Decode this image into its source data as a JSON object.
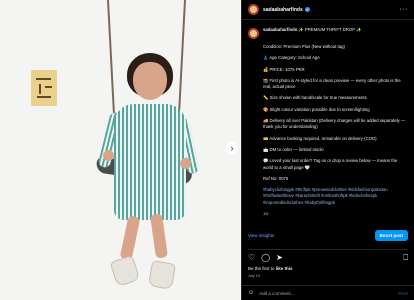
{
  "header": {
    "username": "sadaabaharfinds",
    "verified_glyph": "✓",
    "more_icon": "more-horizontal-icon",
    "more_label": "···"
  },
  "photo": {
    "next_label": "›"
  },
  "caption": {
    "username": "sadaabaharfinds",
    "title": "✨ PREMIUM THRIFT DROP ✨",
    "lines": [
      "Condition: Premium Plus (New without tag)",
      "👗 Age Category: School Age",
      "💰 PRICE: 1075 PKR",
      "📸 First photo is AI-styled for a clean preview — every other photo is the real, actual piece",
      "📏 Size shown with hand/scale for true measurements",
      "🎨 Slight colour variation possible due to screen/lighting",
      "🚚 Delivery all over Pakistan (Delivery charges will be added separately — thank you for understanding)",
      "💳 Advance booking required, remainder on delivery (COD)",
      "📩 DM to order — limited stock!",
      "💬 Loved your last order? Tag us or drop a review below — means the world to a small page 🤍"
    ],
    "ref": "Ref No: 0075",
    "hashtags": "#babyclothingpk #thriftpk #preownedclothes #kidsfashionpakistan #thriftedwithlove #karachithrift #onlinethriftpk #kidsclothespk #importedkidsclothes #babythriftingpk",
    "timestamp": "1w"
  },
  "insights": {
    "view_label": "View insights",
    "boost_label": "Boost post"
  },
  "actions": {
    "like_icon": "heart-icon",
    "comment_icon": "comment-icon",
    "share_icon": "share-icon",
    "save_icon": "bookmark-icon",
    "like_glyph": "♡",
    "comment_glyph": "◯",
    "share_glyph": "➤",
    "save_glyph": "⎕"
  },
  "likes": {
    "prefix": "Be the first to",
    "cta": "like this"
  },
  "date": "July 19",
  "comment": {
    "emoji_glyph": "☺",
    "placeholder": "Add a comment...",
    "post_label": "Post"
  }
}
